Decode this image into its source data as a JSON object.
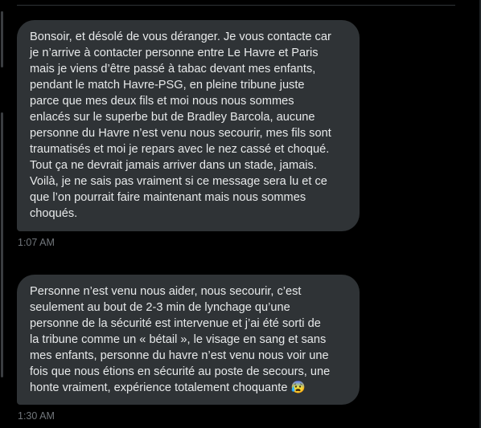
{
  "messages": [
    {
      "text": "Bonsoir, et désolé de vous déranger. Je vous contacte car\nje n’arrive à contacter personne entre Le Havre et Paris\nmais je viens d’être passé à tabac devant mes enfants,\npendant le match Havre-PSG, en pleine tribune juste\nparce que mes deux fils et moi nous nous sommes\nenlacés sur le superbe but de Bradley Barcola, aucune\npersonne du Havre n’est venu nous secourir, mes fils sont\ntraumatisés et moi je repars avec le nez cassé et choqué.\nTout ça ne devrait jamais arriver dans un stade, jamais.\nVoilà, je ne sais pas vraiment si ce message sera lu et ce\nque l’on pourrait faire maintenant mais nous sommes\nchoqués.",
      "time": "1:07 AM"
    },
    {
      "text": "Personne n’est venu nous aider, nous secourir, c’est\nseulement au bout de 2-3 min de lynchage qu’une\npersonne de la sécurité est intervenue et j’ai été sorti de\nla tribune comme un « bétail », le visage en sang et sans\nmes enfants, personne du havre n’est venu nous voir une\nfois que nous étions en sécurité au poste de secours, une\nhonte vraiment, expérience totalement choquante 😰",
      "time": "1:30 AM"
    }
  ],
  "colors": {
    "background": "#000000",
    "bubble": "#2f3336",
    "text": "#e7e9ea",
    "timestamp": "#71767b"
  }
}
